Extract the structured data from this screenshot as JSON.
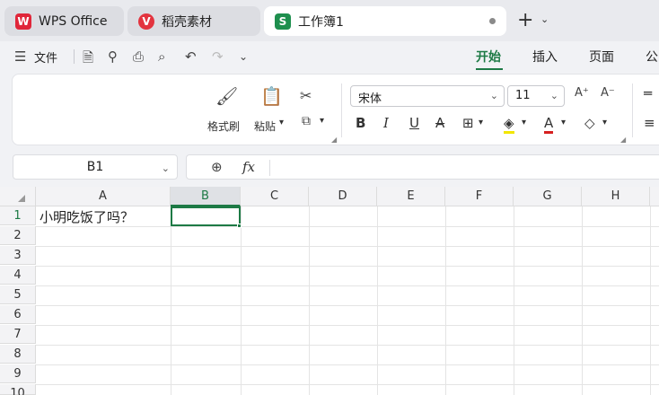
{
  "tabs": [
    {
      "label": "WPS Office",
      "icon": "wps-logo-icon",
      "icon_text": "W"
    },
    {
      "label": "稻壳素材",
      "icon": "daoke-logo-icon",
      "icon_text": "V"
    },
    {
      "label": "工作簿1",
      "icon": "spreadsheet-icon",
      "icon_text": "S",
      "active": true
    }
  ],
  "menu": {
    "file_label": "文件",
    "ribbon_tabs": [
      "开始",
      "插入",
      "页面",
      "公"
    ],
    "active_tab": "开始"
  },
  "ribbon": {
    "format_painter": "格式刷",
    "paste": "粘贴",
    "font_name": "宋体",
    "font_size": "11"
  },
  "formula_bar": {
    "cell_ref": "B1",
    "formula": ""
  },
  "grid": {
    "columns": [
      "A",
      "B",
      "C",
      "D",
      "E",
      "F",
      "G",
      "H"
    ],
    "rows": [
      "1",
      "2",
      "3",
      "4",
      "5",
      "6",
      "7",
      "8",
      "9",
      "10"
    ],
    "selected_column": "B",
    "cells": {
      "A1": "小明吃饭了吗？"
    }
  },
  "colors": {
    "accent": "#1d7a45",
    "wps_red": "#e0263a"
  }
}
